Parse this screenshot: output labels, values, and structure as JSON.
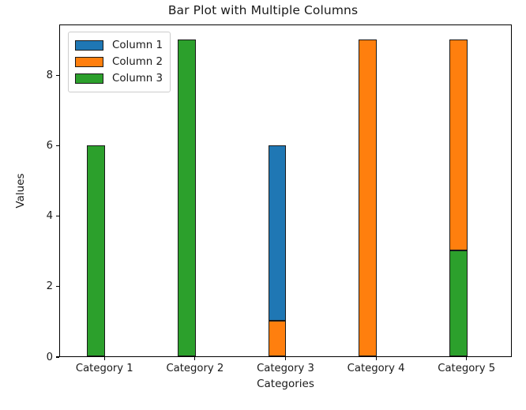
{
  "chart_data": {
    "type": "bar",
    "subtype": "stacked",
    "title": "Bar Plot with Multiple Columns",
    "xlabel": "Categories",
    "ylabel": "Values",
    "categories": [
      "Category 1",
      "Category 2",
      "Category 3",
      "Category 4",
      "Category 5"
    ],
    "series": [
      {
        "name": "Column 1",
        "color": "#1f77b4",
        "values": [
          0,
          0,
          5,
          0,
          0
        ]
      },
      {
        "name": "Column 2",
        "color": "#ff7f0e",
        "values": [
          0,
          0,
          1,
          9,
          6
        ]
      },
      {
        "name": "Column 3",
        "color": "#2ca02c",
        "values": [
          6,
          9,
          0,
          0,
          3
        ]
      }
    ],
    "stack_totals": [
      6,
      9,
      6,
      9,
      9
    ],
    "segments": [
      {
        "category": "Category 1",
        "parts": [
          {
            "series": "Column 3",
            "color": "#2ca02c",
            "base": 0,
            "top": 6
          }
        ]
      },
      {
        "category": "Category 2",
        "parts": [
          {
            "series": "Column 3",
            "color": "#2ca02c",
            "base": 0,
            "top": 9
          }
        ]
      },
      {
        "category": "Category 3",
        "parts": [
          {
            "series": "Column 2",
            "color": "#ff7f0e",
            "base": 0,
            "top": 1
          },
          {
            "series": "Column 1",
            "color": "#1f77b4",
            "base": 1,
            "top": 6
          }
        ]
      },
      {
        "category": "Category 4",
        "parts": [
          {
            "series": "Column 2",
            "color": "#ff7f0e",
            "base": 0,
            "top": 9
          }
        ]
      },
      {
        "category": "Category 5",
        "parts": [
          {
            "series": "Column 3",
            "color": "#2ca02c",
            "base": 0,
            "top": 3
          },
          {
            "series": "Column 2",
            "color": "#ff7f0e",
            "base": 3,
            "top": 9
          }
        ]
      }
    ],
    "yticks": [
      0,
      2,
      4,
      6,
      8
    ],
    "ytick_labels": [
      "0",
      "2",
      "4",
      "6",
      "8"
    ],
    "ylim": [
      0,
      9.45
    ],
    "xlim": [
      -0.5,
      4.5
    ],
    "grid": false,
    "legend": {
      "position": "upper left",
      "entries": [
        {
          "label": "Column 1",
          "color": "#1f77b4"
        },
        {
          "label": "Column 2",
          "color": "#ff7f0e"
        },
        {
          "label": "Column 3",
          "color": "#2ca02c"
        }
      ]
    },
    "bar_edge_color": "#1a1a1a",
    "bar_width_fraction": 0.2
  }
}
